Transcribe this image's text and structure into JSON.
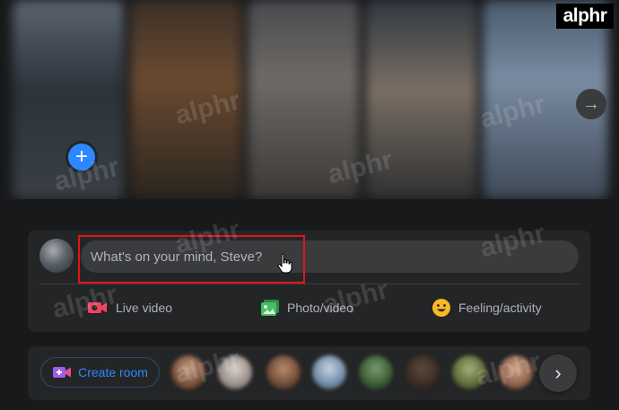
{
  "brand": {
    "badge_text": "alphr"
  },
  "watermark": {
    "text": "alphr"
  },
  "stories": {
    "add_story_symbol": "+",
    "next_symbol": "→"
  },
  "composer": {
    "placeholder": "What's on your mind, Steve?",
    "actions": [
      {
        "label": "Live video",
        "icon": "live-video-icon",
        "color": "#f3425f"
      },
      {
        "label": "Photo/video",
        "icon": "photo-icon",
        "color": "#45bd62"
      },
      {
        "label": "Feeling/activity",
        "icon": "feeling-icon",
        "color": "#f7b928"
      }
    ],
    "highlight_color": "#e0151b"
  },
  "rooms": {
    "create_label": "Create room",
    "next_symbol": "›"
  },
  "colors": {
    "accent": "#2d88ff",
    "background": "#18191a",
    "card": "#242526",
    "input": "#3a3b3c",
    "secondary_text": "#b0b3b8"
  }
}
